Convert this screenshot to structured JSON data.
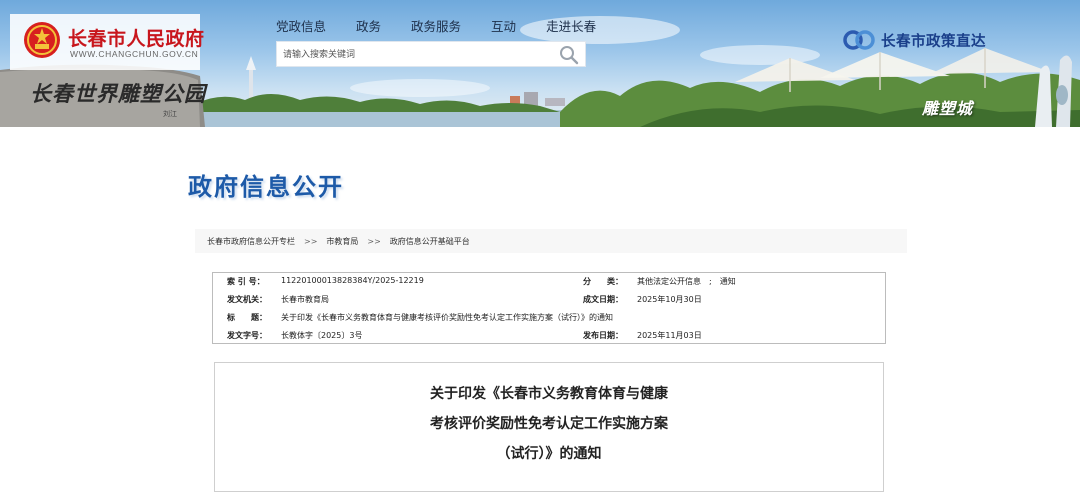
{
  "header": {
    "site_name": "长春市人民政府",
    "site_url": "WWW.CHANGCHUN.GOV.CN",
    "nav": [
      "党政信息",
      "政务",
      "政务服务",
      "互动",
      "走进长春"
    ],
    "search_placeholder": "请输入搜索关键词",
    "policy_label": "长春市政策直达",
    "stone_text": "长春世界雕塑公园",
    "stone_sign": "刘江",
    "district_text": "雕塑城"
  },
  "section_title": "政府信息公开",
  "breadcrumb": [
    "长春市政府信息公开专栏",
    "市教育局",
    "政府信息公开基础平台"
  ],
  "breadcrumb_sep": ">>",
  "meta": {
    "index_label": "索 引 号：",
    "index_value": "11220100013828384Y/2025-12219",
    "category_label": "分　　类：",
    "category_value": "其他法定公开信息　;　通知",
    "issuer_label": "发文机关：",
    "issuer_value": "长春市教育局",
    "date_written_label": "成文日期：",
    "date_written_value": "2025年10月30日",
    "title_label": "标　　题：",
    "title_value": "关于印发《长春市义务教育体育与健康考核评价奖励性免考认定工作实施方案（试行）》的通知",
    "doc_no_label": "发文字号：",
    "doc_no_value": "长教体字〔2025〕3号",
    "publish_label": "发布日期：",
    "publish_value": "2025年11月03日"
  },
  "document": {
    "title_lines": [
      "关于印发《长春市义务教育体育与健康",
      "考核评价奖励性免考认定工作实施方案",
      "（试行）》的通知"
    ]
  },
  "colors": {
    "site_red": "#c8161d",
    "title_blue": "#1d5aa8",
    "policy_blue": "#1a3f8a"
  }
}
